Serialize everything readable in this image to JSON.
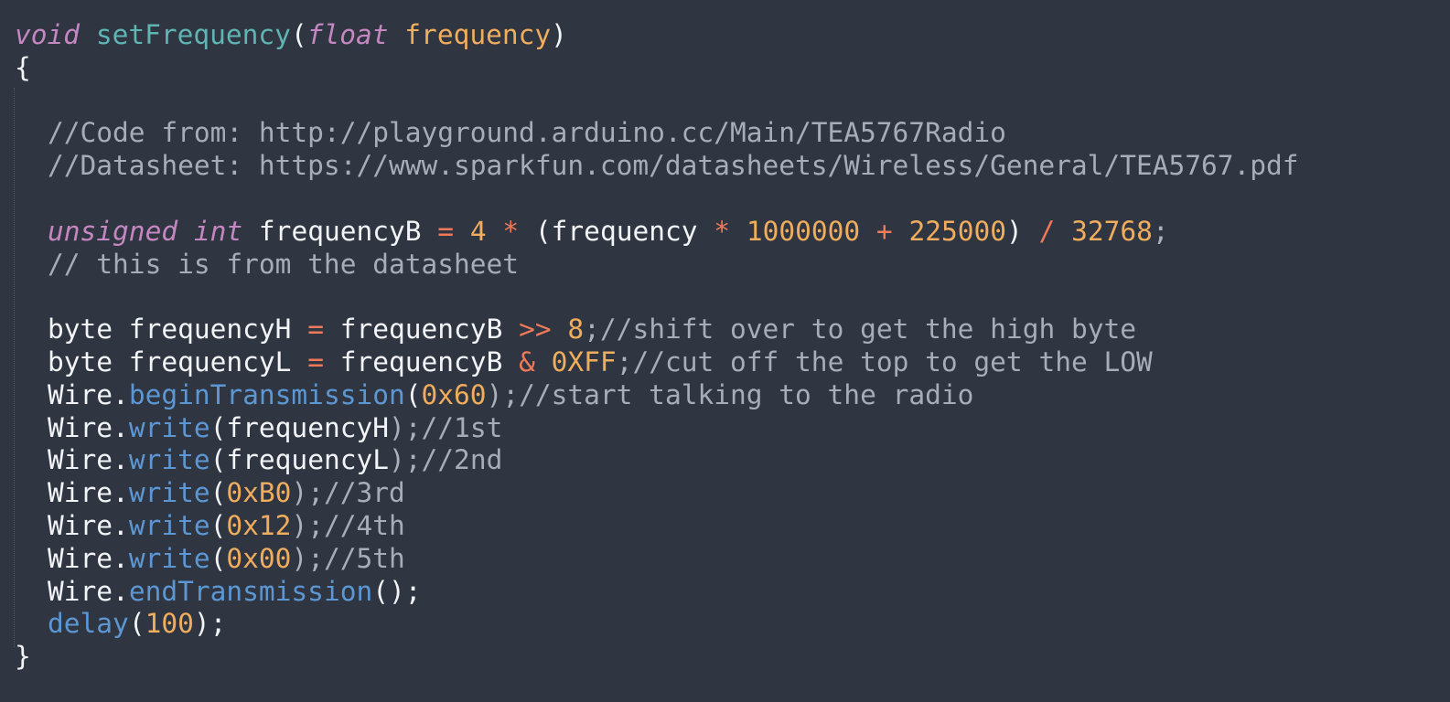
{
  "code": {
    "signature": {
      "ret": "void",
      "name": "setFrequency",
      "open": "(",
      "ptype": "float",
      "pname": "frequency",
      "close": ")"
    },
    "open_brace": "{",
    "comment_source": "//Code from: http://playground.arduino.cc/Main/TEA5767Radio",
    "comment_datasheet": "//Datasheet: https://www.sparkfun.com/datasheets/Wireless/General/TEA5767.pdf",
    "calc": {
      "type1": "unsigned",
      "type2": "int",
      "var": "frequencyB",
      "assign": "=",
      "n4": "4",
      "mul1": "*",
      "lpar": "(",
      "freq": "frequency",
      "mul2": "*",
      "n1m": "1000000",
      "plus": "+",
      "n225": "225000",
      "rpar": ")",
      "div": "/",
      "n32768": "32768",
      "semi": ";"
    },
    "comment_calc": "// this is from the datasheet",
    "high": {
      "decl": "byte frequencyH",
      "assign": "=",
      "src": "frequencyB",
      "op": ">>",
      "num": "8",
      "semi": ";",
      "comment": "//shift over to get the high byte"
    },
    "low": {
      "decl": "byte frequencyL",
      "assign": "=",
      "src": "frequencyB",
      "op": "&",
      "num": "0XFF",
      "semi": ";",
      "comment": "//cut off the top to get the LOW"
    },
    "begin": {
      "obj": "Wire.",
      "method": "beginTransmission",
      "open": "(",
      "arg": "0x60",
      "close": ");",
      "comment": "//start talking to the radio"
    },
    "writes": [
      {
        "obj": "Wire.",
        "method": "write",
        "open": "(",
        "arg": "frequencyH",
        "close": ");",
        "comment": "//1st"
      },
      {
        "obj": "Wire.",
        "method": "write",
        "open": "(",
        "arg": "frequencyL",
        "close": ");",
        "comment": "//2nd"
      },
      {
        "obj": "Wire.",
        "method": "write",
        "open": "(",
        "arg": "0xB0",
        "close": ");",
        "comment": "//3rd"
      },
      {
        "obj": "Wire.",
        "method": "write",
        "open": "(",
        "arg": "0x12",
        "close": ");",
        "comment": "//4th"
      },
      {
        "obj": "Wire.",
        "method": "write",
        "open": "(",
        "arg": "0x00",
        "close": ");",
        "comment": "//5th"
      }
    ],
    "end": {
      "obj": "Wire.",
      "method": "endTransmission",
      "parens": "();"
    },
    "delay": {
      "fn": "delay",
      "open": "(",
      "arg": "100",
      "close": ");"
    },
    "close_brace": "}"
  },
  "colors": {
    "background": "#303641",
    "keyword": "#c587c1",
    "function_name": "#5fb5b3",
    "number": "#f0ad5e",
    "operator": "#ef7a5a",
    "method": "#5d97d3",
    "comment": "#a6adb8",
    "plain": "#f2f4f7"
  }
}
